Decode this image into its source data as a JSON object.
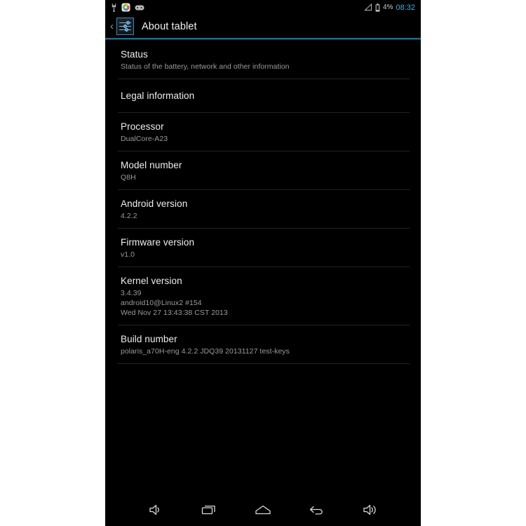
{
  "status_bar": {
    "left_icons": [
      {
        "name": "usb-icon",
        "label": "USB"
      },
      {
        "name": "gallery-icon",
        "label": "Gallery"
      },
      {
        "name": "sd-card-icon",
        "label": "Storage"
      }
    ],
    "signal_icon": "signal-triangle-icon",
    "battery_icon": "battery-icon",
    "battery_percent": "4%",
    "clock": "08:32",
    "clock_color": "#33b5e5"
  },
  "header": {
    "back_chevron": "‹",
    "app_icon": "settings-sliders-icon",
    "title": "About tablet",
    "accent_color": "#1b6d91"
  },
  "settings": {
    "items": [
      {
        "name": "status",
        "title": "Status",
        "sublines": [
          "Status of the battery, network and other information"
        ]
      },
      {
        "name": "legal-information",
        "title": "Legal information",
        "sublines": []
      },
      {
        "name": "processor",
        "title": "Processor",
        "sublines": [
          "DualCore-A23"
        ]
      },
      {
        "name": "model-number",
        "title": "Model number",
        "sublines": [
          "Q8H"
        ]
      },
      {
        "name": "android-version",
        "title": "Android version",
        "sublines": [
          "4.2.2"
        ]
      },
      {
        "name": "firmware-version",
        "title": "Firmware version",
        "sublines": [
          "v1.0"
        ]
      },
      {
        "name": "kernel-version",
        "title": "Kernel version",
        "sublines": [
          "3.4.39",
          "android10@Linux2 #154",
          "Wed Nov 27 13:43:38 CST 2013"
        ]
      },
      {
        "name": "build-number",
        "title": "Build number",
        "sublines": [
          "polaris_a70H-eng 4.2.2 JDQ39 20131127 test-keys"
        ]
      }
    ]
  },
  "nav_bar": {
    "buttons": [
      {
        "name": "volume-down-button",
        "icon": "volume-down-icon",
        "label": "Volume down"
      },
      {
        "name": "recents-button",
        "icon": "recent-apps-icon",
        "label": "Recent apps"
      },
      {
        "name": "home-button",
        "icon": "home-icon",
        "label": "Home"
      },
      {
        "name": "back-button",
        "icon": "back-arrow-icon",
        "label": "Back"
      },
      {
        "name": "volume-up-button",
        "icon": "volume-up-icon",
        "label": "Volume up"
      }
    ]
  }
}
